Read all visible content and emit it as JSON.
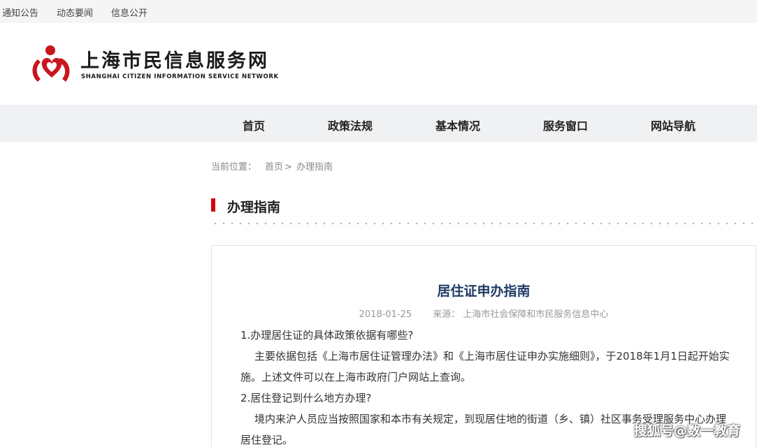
{
  "topbar": {
    "links": [
      "通知公告",
      "动态要闻",
      "信息公开"
    ]
  },
  "header": {
    "logo_cn": "上海市民信息服务网",
    "logo_en": "SHANGHAI CITIZEN INFORMATION SERVICE NETWORK",
    "brand_color": "#c8161d"
  },
  "nav": {
    "items": [
      "首页",
      "政策法规",
      "基本情况",
      "服务窗口",
      "网站导航"
    ]
  },
  "breadcrumb": {
    "prefix": "当前位置：",
    "home": "首页",
    "separator": ">",
    "current": "办理指南"
  },
  "section": {
    "title": "办理指南",
    "accent_color": "#d7000f"
  },
  "article": {
    "title": "居住证申办指南",
    "date": "2018-01-25",
    "source_label": "来源：",
    "source": "上海市社会保障和市民服务信息中心",
    "paragraphs": [
      "1.办理居住证的具体政策依据有哪些?",
      "主要依据包括《上海市居住证管理办法》和《上海市居住证申办实施细则》，于2018年1月1日起开始实施。上述文件可以在上海市政府门户网站上查询。",
      "2.居住登记到什么地方办理?",
      "境内来沪人员应当按照国家和本市有关规定，到现居住地的街道（乡、镇）社区事务受理服务中心办理居住登记。"
    ]
  },
  "watermark": "搜狐号@数一教育"
}
